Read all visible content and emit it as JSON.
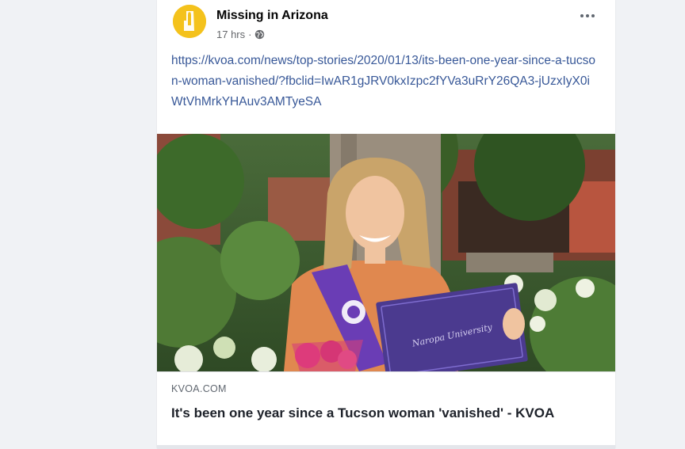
{
  "post": {
    "page_name": "Missing in Arizona",
    "timestamp": "17 hrs",
    "separator": "·",
    "privacy_icon": "globe-icon",
    "link_text": "https://kvoa.com/news/top-stories/2020/01/13/its-been-one-year-since-a-tucson-woman-vanished/?fbclid=IwAR1gJRV0kxIzpc2fYVa3uRrY26QA3-jUzxIyX0iWtVhMrkYHAuv3AMTyeSA",
    "more_icon": "more-options-icon"
  },
  "link_preview": {
    "domain": "KVOA.COM",
    "title": "It's been one year since a Tucson woman 'vanished' - KVOA",
    "diploma_text": "Naropa University"
  },
  "colors": {
    "link": "#385898",
    "avatar": "#f4c21c",
    "background": "#f0f2f5"
  }
}
